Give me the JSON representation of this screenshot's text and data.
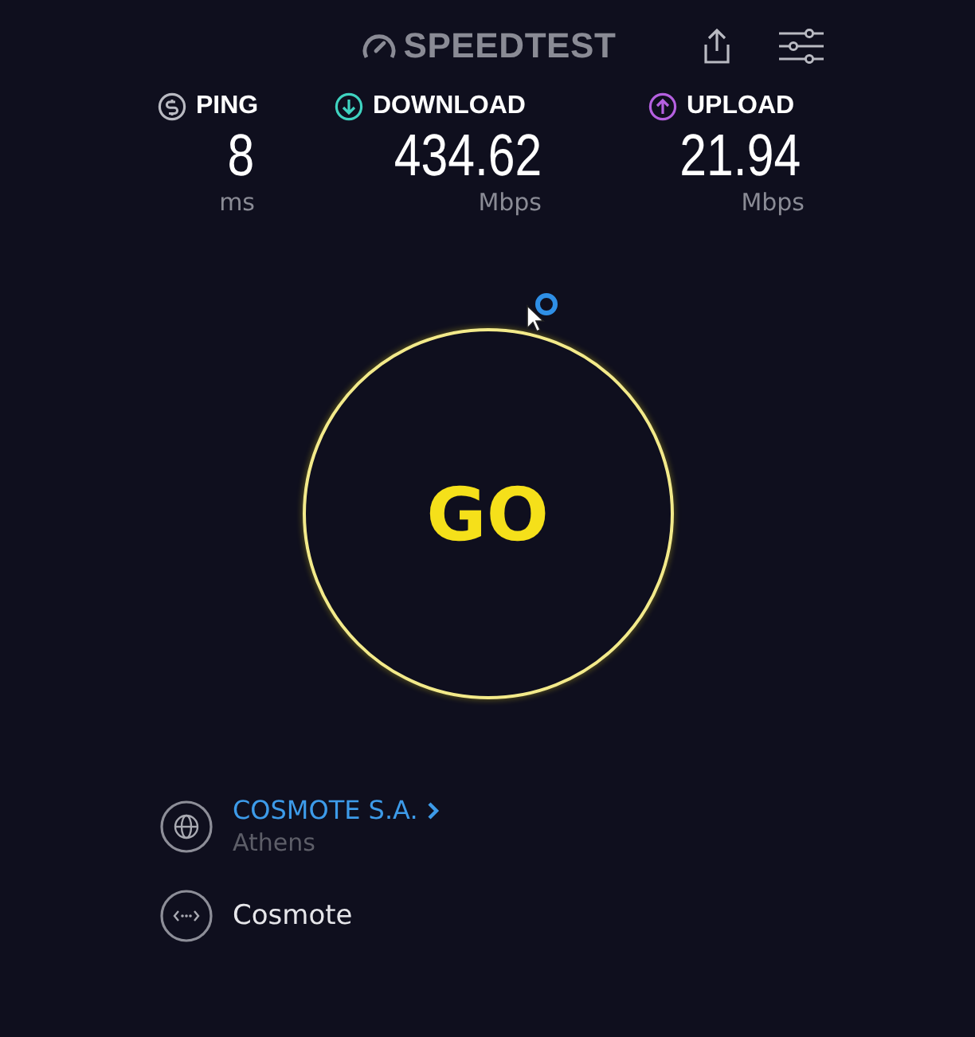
{
  "header": {
    "logo": "SPEEDTEST"
  },
  "metrics": [
    {
      "kind": "ping",
      "label": "PING",
      "value": "8",
      "unit": "ms"
    },
    {
      "kind": "download",
      "label": "DOWNLOAD",
      "value": "434.62",
      "unit": "Mbps"
    },
    {
      "kind": "upload",
      "label": "UPLOAD",
      "value": "21.94",
      "unit": "Mbps"
    }
  ],
  "go_button": {
    "label": "GO"
  },
  "provider": {
    "name": "COSMOTE S.A.",
    "location": "Athens"
  },
  "server": {
    "name": "Cosmote"
  }
}
